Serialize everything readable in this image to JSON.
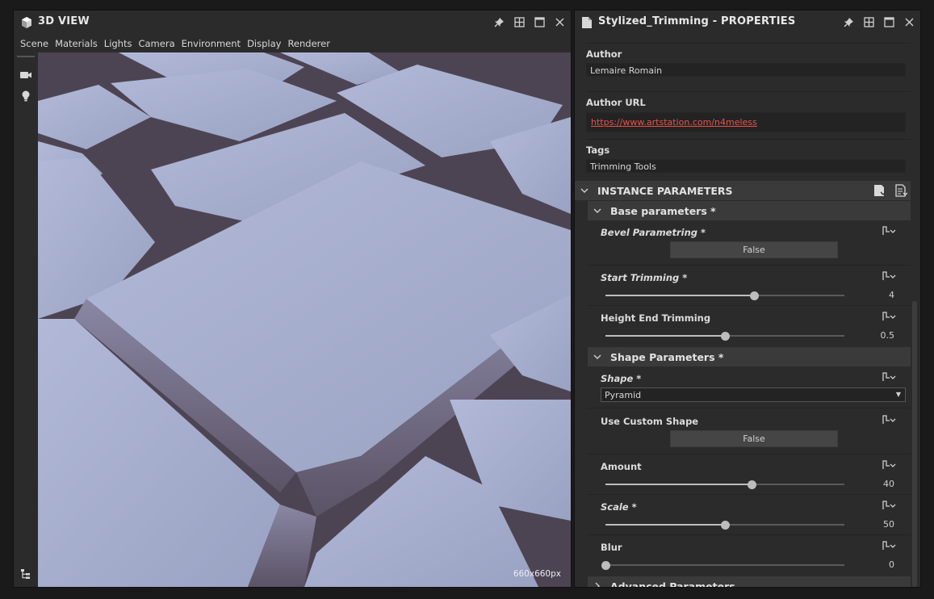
{
  "view": {
    "title": "3D VIEW",
    "menu": [
      "Scene",
      "Materials",
      "Lights",
      "Camera",
      "Environment",
      "Display",
      "Renderer"
    ],
    "resolution": "660x660px",
    "toolbar_icons": [
      "camera-icon",
      "light-bulb-icon",
      "scene-tree-icon"
    ]
  },
  "properties": {
    "title": "Stylized_Trimming - PROPERTIES",
    "author_label": "Author",
    "author_value": "Lemaire Romain",
    "author_url_label": "Author URL",
    "author_url_value": "https://www.artstation.com/n4meless",
    "tags_label": "Tags",
    "tags_value": "Trimming Tools",
    "instance_header": "INSTANCE PARAMETERS",
    "base_header": "Base parameters *",
    "shape_header": "Shape Parameters *",
    "advanced_header": "Advanced Parameters",
    "params": {
      "bevel": {
        "label": "Bevel Parametring *",
        "value": "False"
      },
      "start_trim": {
        "label": "Start Trimming *",
        "value": "4",
        "fraction": 0.62
      },
      "height_end": {
        "label": "Height End Trimming",
        "value": "0.5",
        "fraction": 0.5
      },
      "shape": {
        "label": "Shape *",
        "value": "Pyramid"
      },
      "custom_shape": {
        "label": "Use Custom Shape",
        "value": "False"
      },
      "amount": {
        "label": "Amount",
        "value": "40",
        "fraction": 0.61
      },
      "scale": {
        "label": "Scale *",
        "value": "50",
        "fraction": 0.5
      },
      "blur": {
        "label": "Blur",
        "value": "0",
        "fraction": 0.0
      }
    }
  },
  "colors": {
    "panel_bg": "#2b2b2b",
    "section_bg": "#3a3a3a",
    "link": "#e8504a",
    "stone": "#a9b1d1",
    "groove": "#4a4150"
  }
}
